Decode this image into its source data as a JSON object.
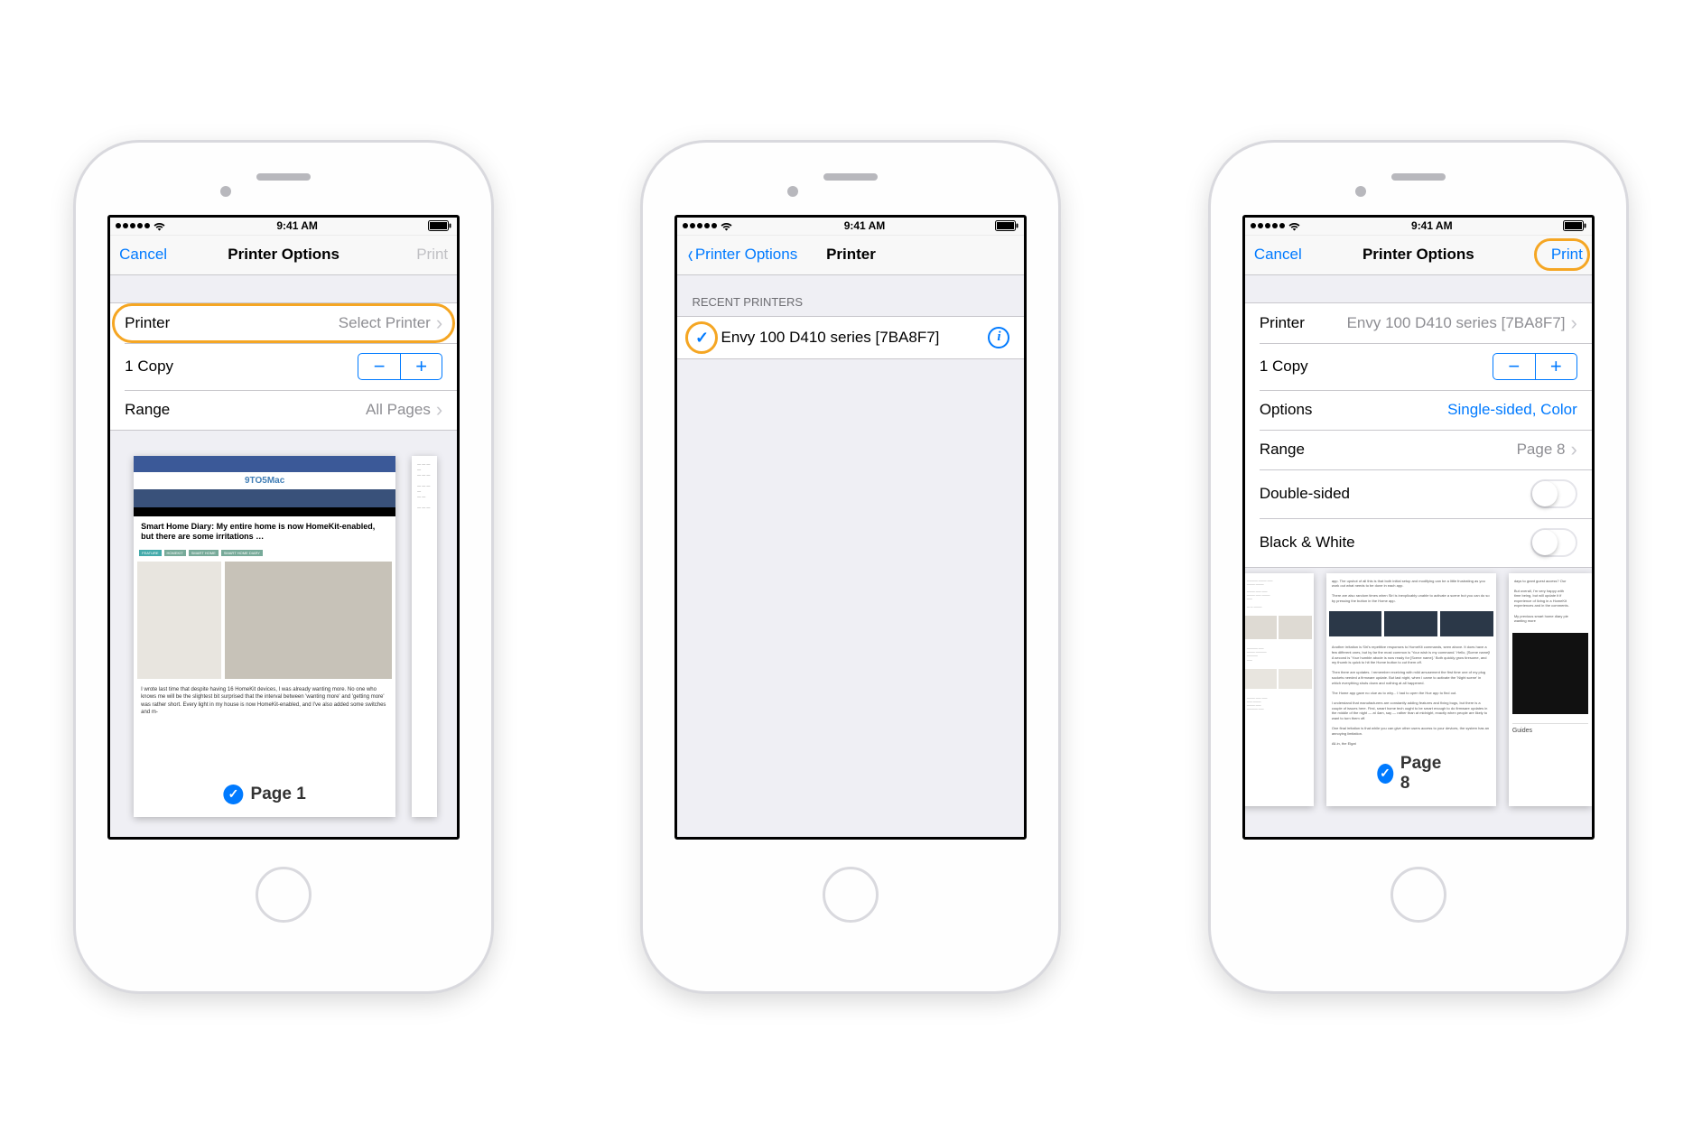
{
  "status_bar": {
    "time": "9:41 AM"
  },
  "phone1": {
    "nav": {
      "left": "Cancel",
      "title": "Printer Options",
      "right": "Print"
    },
    "cells": {
      "printer_label": "Printer",
      "printer_value": "Select Printer",
      "copies_label": "1 Copy",
      "range_label": "Range",
      "range_value": "All Pages"
    },
    "preview": {
      "page_label": "Page 1",
      "website_name": "9TO5Mac",
      "article_title": "Smart Home Diary: My entire home is now HomeKit-enabled, but there are some irritations …",
      "tag1": "FEATURE",
      "tag2": "HOMEKIT",
      "tag3": "SMART HOME",
      "tag4": "SMART HOME DIARY",
      "body_snippet": "I wrote last time that despite having 16 HomeKit devices, I was already wanting more. No one who knows me will be the slightest bit surprised that the interval between 'wanting more' and 'getting more' was rather short. Every light in my house is now HomeKit-enabled, and I've also added some switches and m-"
    }
  },
  "phone2": {
    "nav": {
      "back": "Printer Options",
      "title": "Printer"
    },
    "section_header": "RECENT PRINTERS",
    "printer_name": "Envy 100 D410 series [7BA8F7]"
  },
  "phone3": {
    "nav": {
      "left": "Cancel",
      "title": "Printer Options",
      "right": "Print"
    },
    "cells": {
      "printer_label": "Printer",
      "printer_value": "Envy 100 D410 series [7BA8F7]",
      "copies_label": "1 Copy",
      "options_label": "Options",
      "options_value": "Single-sided, Color",
      "range_label": "Range",
      "range_value": "Page 8",
      "double_sided_label": "Double-sided",
      "bw_label": "Black & White"
    },
    "preview": {
      "page_label": "Page 8"
    }
  }
}
